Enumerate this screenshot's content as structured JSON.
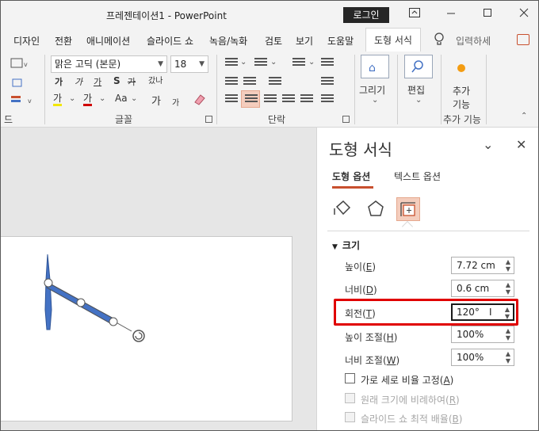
{
  "window": {
    "title": "프레젠테이션1  -  PowerPoint",
    "login_label": "로그인"
  },
  "menu": {
    "items": [
      "디자인",
      "전환",
      "애니메이션",
      "슬라이드 쇼",
      "녹음/녹화",
      "검토",
      "보기",
      "도움말",
      "도형 서식"
    ],
    "tell_me_placeholder": "입력하세"
  },
  "ribbon": {
    "font_name": "맑은 고딕 (본문)",
    "font_size": "18",
    "bold_labels": [
      "가",
      "가",
      "가",
      "S",
      "갔나"
    ],
    "row3": [
      "가",
      "가",
      "Aa",
      "가",
      "가"
    ],
    "groups": {
      "left_partial": "드",
      "font": "글꼴",
      "paragraph": "단락",
      "addin": "추가 기능"
    },
    "draw_label": "그리기",
    "edit_label": "편집",
    "addin_label_1": "추가",
    "addin_label_2": "기능"
  },
  "pane": {
    "title": "도형 서식",
    "tabs": [
      "도형 옵션",
      "텍스트 옵션"
    ],
    "icons": [
      "fill-line-icon",
      "effects-icon",
      "size-properties-icon"
    ],
    "section_title": "크기",
    "properties": [
      {
        "label": "높이",
        "key": "E",
        "value": "7.72 cm"
      },
      {
        "label": "너비",
        "key": "D",
        "value": "0.6 cm"
      },
      {
        "label": "회전",
        "key": "T",
        "value": "120°"
      },
      {
        "label": "높이 조절",
        "key": "H",
        "value": "100%"
      },
      {
        "label": "너비 조절",
        "key": "W",
        "value": "100%"
      }
    ],
    "checkboxes": [
      {
        "label": "가로 세로 비율 고정",
        "key": "A",
        "disabled": false
      },
      {
        "label": "원래 크기에 비례하여",
        "key": "R",
        "disabled": true
      },
      {
        "label": "슬라이드 쇼 최적 배율",
        "key": "B",
        "disabled": true
      }
    ]
  },
  "colors": {
    "accent": "#c8502e",
    "highlight": "#e00000",
    "shape_fill": "#4472c4"
  }
}
